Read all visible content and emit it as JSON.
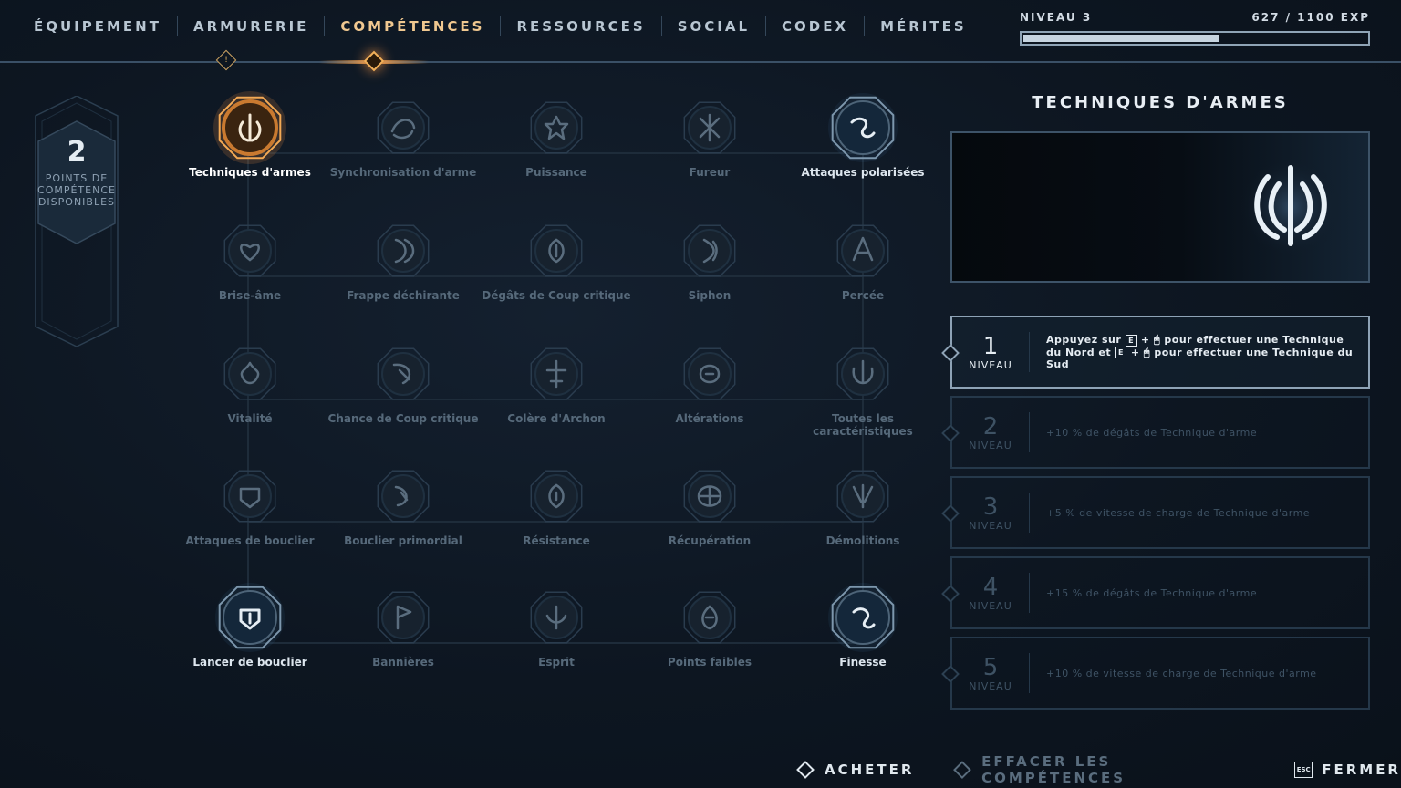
{
  "nav": {
    "tabs": [
      {
        "label": "ÉQUIPEMENT",
        "active": false
      },
      {
        "label": "ARMURERIE",
        "active": false
      },
      {
        "label": "COMPÉTENCES",
        "active": true
      },
      {
        "label": "RESSOURCES",
        "active": false
      },
      {
        "label": "SOCIAL",
        "active": false
      },
      {
        "label": "CODEX",
        "active": false
      },
      {
        "label": "MÉRITES",
        "active": false
      }
    ],
    "alert_glyph": "!"
  },
  "level": {
    "label": "NIVEAU 3",
    "xp_text": "627  /  1100 EXP",
    "xp_current": 627,
    "xp_max": 1100
  },
  "points": {
    "count": "2",
    "label": "POINTS DE COMPÉTENCE DISPONIBLES"
  },
  "skills": [
    {
      "label": "Techniques d'armes",
      "state": "selected",
      "icon": "trident-emblem-icon"
    },
    {
      "label": "Synchronisation d'arme",
      "state": "locked",
      "icon": "sync-icon"
    },
    {
      "label": "Puissance",
      "state": "locked",
      "icon": "power-icon"
    },
    {
      "label": "Fureur",
      "state": "locked",
      "icon": "fury-icon"
    },
    {
      "label": "Attaques polarisées",
      "state": "unlocked",
      "icon": "polarized-icon"
    },
    {
      "label": "Brise-âme",
      "state": "locked",
      "icon": "soulbreak-icon"
    },
    {
      "label": "Frappe déchirante",
      "state": "locked",
      "icon": "tearing-strike-icon"
    },
    {
      "label": "Dégâts de Coup critique",
      "state": "locked",
      "icon": "crit-damage-icon"
    },
    {
      "label": "Siphon",
      "state": "locked",
      "icon": "siphon-icon"
    },
    {
      "label": "Percée",
      "state": "locked",
      "icon": "pierce-icon"
    },
    {
      "label": "Vitalité",
      "state": "locked",
      "icon": "vitality-icon"
    },
    {
      "label": "Chance de Coup critique",
      "state": "locked",
      "icon": "crit-chance-icon"
    },
    {
      "label": "Colère d'Archon",
      "state": "locked",
      "icon": "archon-wrath-icon"
    },
    {
      "label": "Altérations",
      "state": "locked",
      "icon": "alterations-icon"
    },
    {
      "label": "Toutes les caractéristiques",
      "state": "locked",
      "icon": "all-stats-icon"
    },
    {
      "label": "Attaques de bouclier",
      "state": "locked",
      "icon": "shield-attack-icon"
    },
    {
      "label": "Bouclier primordial",
      "state": "locked",
      "icon": "primordial-shield-icon"
    },
    {
      "label": "Résistance",
      "state": "locked",
      "icon": "resistance-icon"
    },
    {
      "label": "Récupération",
      "state": "locked",
      "icon": "recovery-icon"
    },
    {
      "label": "Démolitions",
      "state": "locked",
      "icon": "demolition-icon"
    },
    {
      "label": "Lancer de bouclier",
      "state": "unlocked",
      "icon": "shield-throw-icon"
    },
    {
      "label": "Bannières",
      "state": "locked",
      "icon": "banner-icon"
    },
    {
      "label": "Esprit",
      "state": "locked",
      "icon": "spirit-icon"
    },
    {
      "label": "Points faibles",
      "state": "locked",
      "icon": "weak-points-icon"
    },
    {
      "label": "Finesse",
      "state": "unlocked",
      "icon": "finesse-icon"
    }
  ],
  "detail": {
    "title": "TECHNIQUES D'ARMES",
    "emblem": "trident-emblem-icon",
    "levels": [
      {
        "num": "1",
        "word": "NIVEAU",
        "current": true,
        "parts": [
          "Appuyez sur ",
          "E",
          " + ",
          "🖱",
          " pour effectuer une Technique du Nord et ",
          "E",
          " + ",
          "🖱",
          " pour effectuer une Technique du Sud"
        ]
      },
      {
        "num": "2",
        "word": "NIVEAU",
        "current": false,
        "text": "+10 % de dégâts de Technique d'arme"
      },
      {
        "num": "3",
        "word": "NIVEAU",
        "current": false,
        "text": "+5 % de vitesse de charge de Technique d'arme"
      },
      {
        "num": "4",
        "word": "NIVEAU",
        "current": false,
        "text": "+15 % de dégâts de Technique d'arme"
      },
      {
        "num": "5",
        "word": "NIVEAU",
        "current": false,
        "text": "+10 % de vitesse de charge de Technique d'arme"
      }
    ]
  },
  "actions": {
    "buy": "ACHETER",
    "reset": "EFFACER LES COMPÉTENCES",
    "close_key": "ESC",
    "close": "FERMER"
  },
  "colors": {
    "accent_gold": "#f0c890",
    "locked": "#56697a",
    "unlocked": "#dde6ee"
  }
}
